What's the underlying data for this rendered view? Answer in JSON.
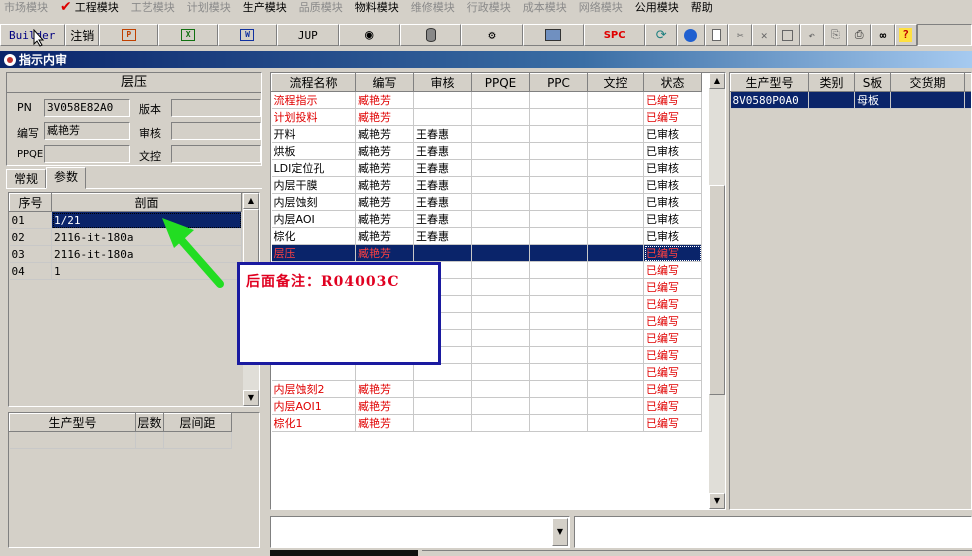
{
  "menu": [
    {
      "label": "市场模块",
      "enabled": false,
      "checked": false
    },
    {
      "label": "工程模块",
      "enabled": true,
      "checked": true
    },
    {
      "label": "工艺模块",
      "enabled": false,
      "checked": false
    },
    {
      "label": "计划模块",
      "enabled": false,
      "checked": false
    },
    {
      "label": "生产模块",
      "enabled": true,
      "checked": false
    },
    {
      "label": "品质模块",
      "enabled": false,
      "checked": false
    },
    {
      "label": "物料模块",
      "enabled": true,
      "checked": false
    },
    {
      "label": "维修模块",
      "enabled": false,
      "checked": false
    },
    {
      "label": "行政模块",
      "enabled": false,
      "checked": false
    },
    {
      "label": "成本模块",
      "enabled": false,
      "checked": false
    },
    {
      "label": "网络模块",
      "enabled": false,
      "checked": false
    },
    {
      "label": "公用模块",
      "enabled": true,
      "checked": false
    },
    {
      "label": "帮助",
      "enabled": true,
      "checked": false
    }
  ],
  "toolbar": {
    "builder_label": "Builder",
    "logout_label": "注销",
    "jup_label": "JUP",
    "spc_label": "SPC"
  },
  "window": {
    "title": "指示内审"
  },
  "header_group": {
    "title": "层压",
    "pn_label": "PN",
    "pn_value": "3V058E82A0",
    "version_label": "版本",
    "version_value": "",
    "author_label": "编写",
    "author_value": "臧艳芳",
    "review_label": "审核",
    "review_value": "",
    "ppqe_label": "PPQE",
    "ppqe_value": "",
    "doccontrol_label": "文控",
    "doccontrol_value": ""
  },
  "tabs": {
    "general": "常规",
    "params": "参数"
  },
  "section_grid": {
    "headers": [
      "序号",
      "剖面"
    ],
    "rows": [
      {
        "no": "01",
        "section": "1/21"
      },
      {
        "no": "02",
        "section": "2116-it-180a"
      },
      {
        "no": "03",
        "section": "2116-it-180a"
      },
      {
        "no": "04",
        "section": "1"
      }
    ]
  },
  "model_grid": {
    "headers": [
      "生产型号",
      "层数",
      "层间距"
    ]
  },
  "process_grid": {
    "headers": [
      "流程名称",
      "编写",
      "审核",
      "PPQE",
      "PPC",
      "文控",
      "状态"
    ],
    "rows": [
      {
        "name": "流程指示",
        "author": "臧艳芳",
        "reviewer": "",
        "status": "已编写",
        "style": "red"
      },
      {
        "name": "计划投料",
        "author": "臧艳芳",
        "reviewer": "",
        "status": "已编写",
        "style": "red"
      },
      {
        "name": "开料",
        "author": "臧艳芳",
        "reviewer": "王春惠",
        "status": "已审核",
        "style": "normal"
      },
      {
        "name": "烘板",
        "author": "臧艳芳",
        "reviewer": "王春惠",
        "status": "已审核",
        "style": "normal"
      },
      {
        "name": "LDI定位孔",
        "author": "臧艳芳",
        "reviewer": "王春惠",
        "status": "已审核",
        "style": "normal"
      },
      {
        "name": "内层干膜",
        "author": "臧艳芳",
        "reviewer": "王春惠",
        "status": "已审核",
        "style": "normal"
      },
      {
        "name": "内层蚀刻",
        "author": "臧艳芳",
        "reviewer": "王春惠",
        "status": "已审核",
        "style": "normal"
      },
      {
        "name": "内层AOI",
        "author": "臧艳芳",
        "reviewer": "王春惠",
        "status": "已审核",
        "style": "normal"
      },
      {
        "name": "棕化",
        "author": "臧艳芳",
        "reviewer": "王春惠",
        "status": "已审核",
        "style": "normal"
      },
      {
        "name": "层压",
        "author": "臧艳芳",
        "reviewer": "",
        "status": "已编写",
        "style": "selected"
      },
      {
        "name": "",
        "author": "",
        "reviewer": "",
        "status": "已编写",
        "style": "red"
      },
      {
        "name": "",
        "author": "",
        "reviewer": "",
        "status": "已编写",
        "style": "red"
      },
      {
        "name": "",
        "author": "",
        "reviewer": "",
        "status": "已编写",
        "style": "red"
      },
      {
        "name": "",
        "author": "",
        "reviewer": "",
        "status": "已编写",
        "style": "red"
      },
      {
        "name": "",
        "author": "",
        "reviewer": "",
        "status": "已编写",
        "style": "red"
      },
      {
        "name": "",
        "author": "",
        "reviewer": "",
        "status": "已编写",
        "style": "red"
      },
      {
        "name": "",
        "author": "",
        "reviewer": "",
        "status": "已编写",
        "style": "red"
      },
      {
        "name": "内层蚀刻2",
        "author": "臧艳芳",
        "reviewer": "",
        "status": "已编写",
        "style": "red"
      },
      {
        "name": "内层AOI1",
        "author": "臧艳芳",
        "reviewer": "",
        "status": "已编写",
        "style": "red"
      },
      {
        "name": "棕化1",
        "author": "臧艳芳",
        "reviewer": "",
        "status": "已编写",
        "style": "red"
      }
    ]
  },
  "right_grid": {
    "headers": [
      "生产型号",
      "类别",
      "S板",
      "交货期",
      "客"
    ],
    "rows": [
      {
        "model": "8V0580P0A0",
        "category": "",
        "sboard": "母板",
        "due": "",
        "cust": ""
      }
    ]
  },
  "annotation": {
    "text": "后面备注：R04003C",
    "arrow_color": "#22dd22"
  }
}
